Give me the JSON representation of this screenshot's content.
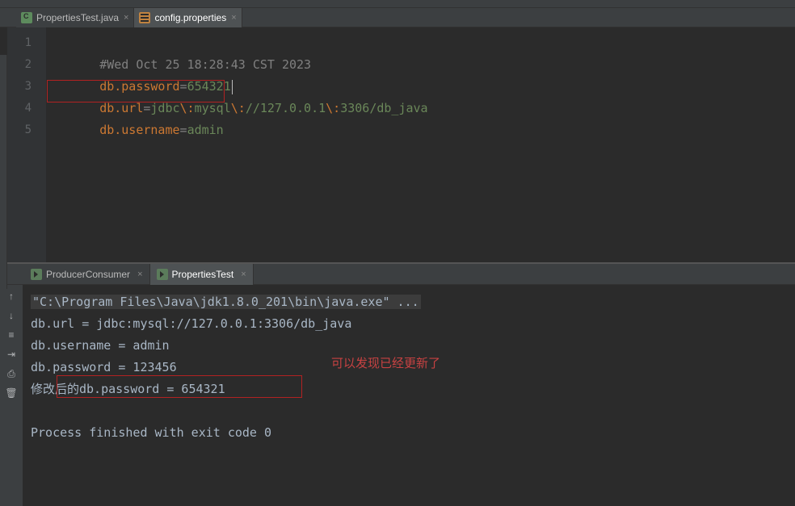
{
  "editor_tabs": [
    {
      "label": "PropertiesTest.java",
      "active": false,
      "icon": "java"
    },
    {
      "label": "config.properties",
      "active": true,
      "icon": "props"
    }
  ],
  "gutter": [
    "1",
    "2",
    "3",
    "4",
    "5"
  ],
  "code": {
    "line1_comment": "#Wed Oct 25 18:28:43 CST 2023",
    "line2_key": "db.password",
    "line2_eq": "=",
    "line2_val": "654321",
    "line3_key": "db.url",
    "line3_eq": "=",
    "line3_v1": "jdbc",
    "line3_e1": "\\:",
    "line3_v2": "mysql",
    "line3_e2": "\\:",
    "line3_v3": "//127.0.0.1",
    "line3_e3": "\\:",
    "line3_v4": "3306/db_java",
    "line4_key": "db.username",
    "line4_eq": "=",
    "line4_val": "admin"
  },
  "console_tabs": [
    {
      "label": "ProducerConsumer",
      "active": false
    },
    {
      "label": "PropertiesTest",
      "active": true
    }
  ],
  "console": {
    "line1": "\"C:\\Program Files\\Java\\jdk1.8.0_201\\bin\\java.exe\" ...",
    "line2": "db.url = jdbc:mysql://127.0.0.1:3306/db_java",
    "line3": "db.username = admin",
    "line4": "db.password = 123456",
    "line5": "修改后的db.password = 654321",
    "line6": "",
    "line7": "Process finished with exit code 0"
  },
  "annotation": "可以发现已经更新了"
}
